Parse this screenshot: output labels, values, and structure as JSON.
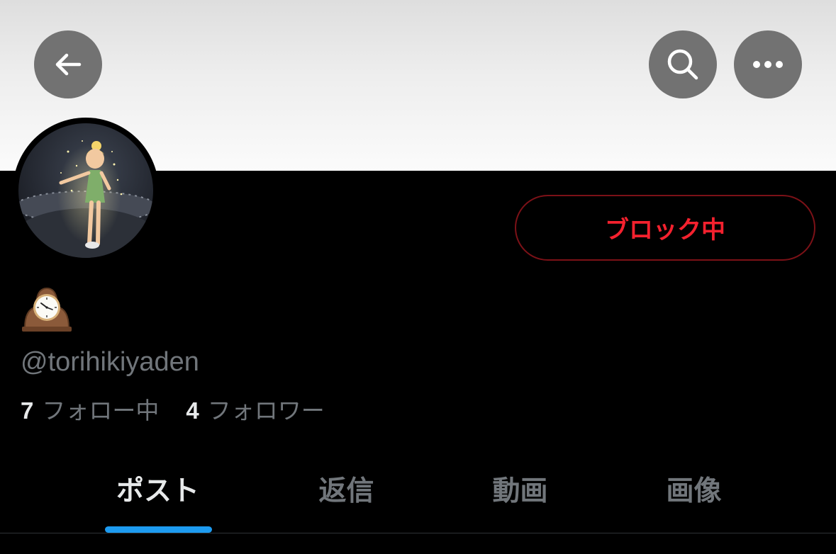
{
  "header": {
    "back_icon": "arrow-left-icon",
    "search_icon": "search-icon",
    "more_icon": "more-horizontal-icon"
  },
  "profile": {
    "avatar_icon": "fairy-avatar-icon",
    "name_emoji": "mantelpiece-clock-icon",
    "handle": "@torihikiyaden",
    "block_button_label": "ブロック中",
    "block_button_color": "#f4212e",
    "following_count": "7",
    "following_label": "フォロー中",
    "followers_count": "4",
    "followers_label": "フォロワー"
  },
  "tabs": [
    {
      "label": "ポスト",
      "active": true
    },
    {
      "label": "返信",
      "active": false
    },
    {
      "label": "動画",
      "active": false
    },
    {
      "label": "画像",
      "active": false
    }
  ],
  "colors": {
    "accent": "#1d9bf0",
    "muted_text": "#71767b",
    "primary_text": "#e7e9ea",
    "background": "#000000"
  }
}
